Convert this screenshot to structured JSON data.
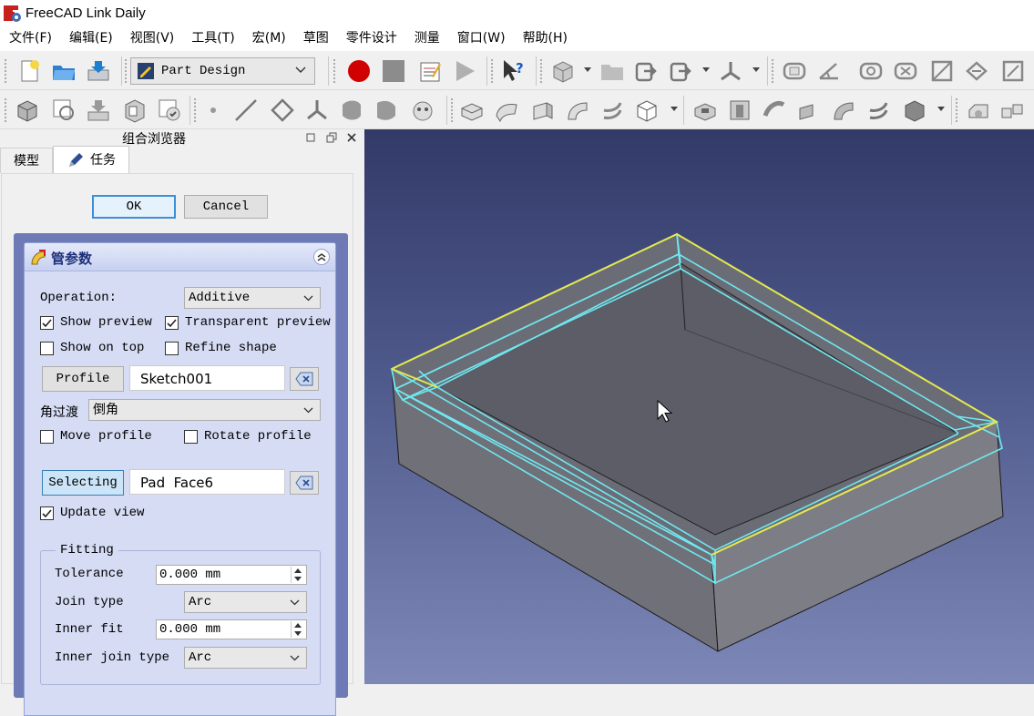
{
  "window": {
    "title": "FreeCAD Link Daily"
  },
  "menu": [
    "文件(F)",
    "编辑(E)",
    "视图(V)",
    "工具(T)",
    "宏(M)",
    "草图",
    "零件设计",
    "测量",
    "窗口(W)",
    "帮助(H)"
  ],
  "workbench": {
    "selected": "Part Design"
  },
  "combo_view": {
    "title": "组合浏览器",
    "tabs": [
      "模型",
      "任务"
    ],
    "active_tab": "任务"
  },
  "task": {
    "ok_label": "OK",
    "cancel_label": "Cancel",
    "box_title": "管参数",
    "operation_label": "Operation:",
    "operation_value": "Additive",
    "show_preview_label": "Show preview",
    "show_preview_checked": true,
    "transparent_preview_label": "Transparent preview",
    "transparent_preview_checked": true,
    "show_on_top_label": "Show on top",
    "show_on_top_checked": false,
    "refine_shape_label": "Refine shape",
    "refine_shape_checked": false,
    "profile_button": "Profile",
    "profile_value": "Sketch001",
    "transition_label": "角过渡",
    "transition_value": "倒角",
    "move_profile_label": "Move profile",
    "move_profile_checked": false,
    "rotate_profile_label": "Rotate profile",
    "rotate_profile_checked": false,
    "selecting_button": "Selecting",
    "selection_value": "Pad  Face6",
    "update_view_label": "Update view",
    "update_view_checked": true,
    "fitting": {
      "title": "Fitting",
      "tolerance_label": "Tolerance",
      "tolerance_value": "0.000 mm",
      "join_type_label": "Join type",
      "join_type_value": "Arc",
      "inner_fit_label": "Inner fit",
      "inner_fit_value": "0.000 mm",
      "inner_join_type_label": "Inner join type",
      "inner_join_type_value": "Arc"
    }
  },
  "colors": {
    "preview_edge": "#6fe8f0",
    "selected_edge": "#e6e84a",
    "viewport_top": "#323a68",
    "viewport_bottom": "#7d88b8"
  }
}
